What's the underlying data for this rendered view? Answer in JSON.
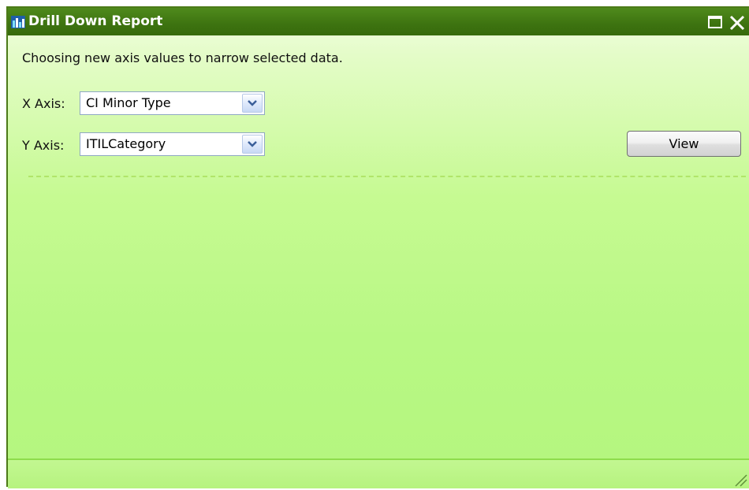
{
  "window": {
    "title": "Drill Down Report",
    "title_icon": "bar-chart-icon",
    "controls": {
      "maximize_icon": "maximize-icon",
      "close_icon": "close-icon"
    }
  },
  "form": {
    "description": "Choosing new axis values to narrow selected data.",
    "x_axis": {
      "label": "X Axis:",
      "value": "CI Minor Type"
    },
    "y_axis": {
      "label": "Y Axis:",
      "value": "ITILCategory"
    },
    "view_button_label": "View"
  },
  "colors": {
    "titlebar": "#3d7310",
    "panel_background": "#b4f67e",
    "divider": "#b0e56a"
  }
}
